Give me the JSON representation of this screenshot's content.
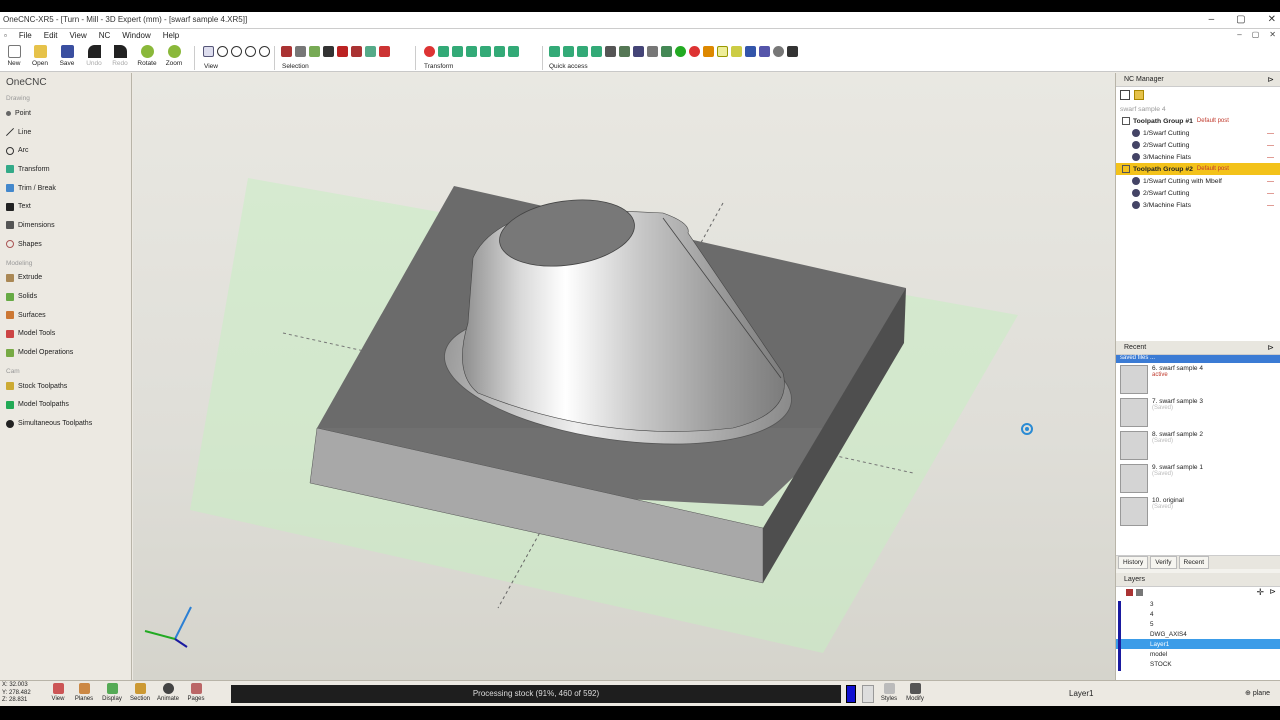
{
  "window": {
    "title": "OneCNC-XR5 - [Turn - Mill - 3D Expert (mm) - [swarf sample 4.XR5]]",
    "buttons": [
      "–",
      "▢",
      "✕"
    ]
  },
  "menu": {
    "items": [
      "File",
      "Edit",
      "View",
      "NC",
      "Window",
      "Help"
    ],
    "mdi": [
      "–",
      "▢",
      "✕"
    ]
  },
  "toolbar": {
    "new": "New",
    "open": "Open",
    "save": "Save",
    "undo": "Undo",
    "redo": "Redo",
    "rotate": "Rotate",
    "zoom": "Zoom",
    "view": "View",
    "selection": "Selection",
    "transform": "Transform",
    "quick_access": "Quick access"
  },
  "left": {
    "title": "OneCNC",
    "sections": {
      "drawing": "Drawing",
      "modeling": "Modeling",
      "nc": "Cam"
    },
    "drawing": [
      "Point",
      "Line",
      "Arc",
      "Transform",
      "Trim / Break",
      "Text",
      "Dimensions",
      "Shapes"
    ],
    "modeling": [
      "Extrude",
      "Solids",
      "Surfaces",
      "Model Tools",
      "Model Operations"
    ],
    "nc": [
      "Stock Toolpaths",
      "Model Toolpaths",
      "Simultaneous Toolpaths"
    ]
  },
  "nc_manager": {
    "title": "NC Manager",
    "file": "swarf sample 4",
    "rows": [
      {
        "label": "Toolpath Group #1",
        "default": "Default post",
        "level": 0,
        "group": true
      },
      {
        "label": "1/Swarf Cutting",
        "level": 1
      },
      {
        "label": "2/Swarf Cutting",
        "level": 1
      },
      {
        "label": "3/Machine Flats",
        "level": 1
      },
      {
        "label": "Toolpath Group #2",
        "default": "Default post",
        "level": 0,
        "group": true,
        "highlight": true
      },
      {
        "label": "1/Swarf Cutting with Mbelf",
        "level": 1
      },
      {
        "label": "2/Swarf Cutting",
        "level": 1
      },
      {
        "label": "3/Machine Flats",
        "level": 1
      }
    ]
  },
  "recent": {
    "title": "Recent",
    "selected": "saved files ...",
    "items": [
      {
        "name": "6. swarf sample 4",
        "state": "active"
      },
      {
        "name": "7. swarf sample 3",
        "state": "(Saved)"
      },
      {
        "name": "8. swarf sample 2",
        "state": "(Saved)"
      },
      {
        "name": "9. swarf sample 1",
        "state": "(Saved)"
      },
      {
        "name": "10. original",
        "state": "(Saved)"
      }
    ],
    "tabs": [
      "History",
      "Verify",
      "Recent"
    ]
  },
  "layers": {
    "title": "Layers",
    "rows": [
      "3",
      "4",
      "5",
      "DWG_AXIS4",
      "Layer1",
      "model",
      "STOCK"
    ],
    "selected": "Layer1"
  },
  "status": {
    "coords": [
      "X: 32.003",
      "Y: 278.482",
      "Z: 28.831"
    ],
    "buttons": [
      "View",
      "Planes",
      "Display",
      "Section",
      "Animate",
      "Pages"
    ],
    "progress": "Processing stock (91%, 460 of 592)",
    "right_buttons": [
      "Styles",
      "Modify"
    ],
    "layer": "Layer1",
    "plane": "plane"
  },
  "colors": {
    "accent": "#f3c21a",
    "selection": "#3b9ce8",
    "plane": "#c5ecc0",
    "stock": "#6b6b6b"
  }
}
